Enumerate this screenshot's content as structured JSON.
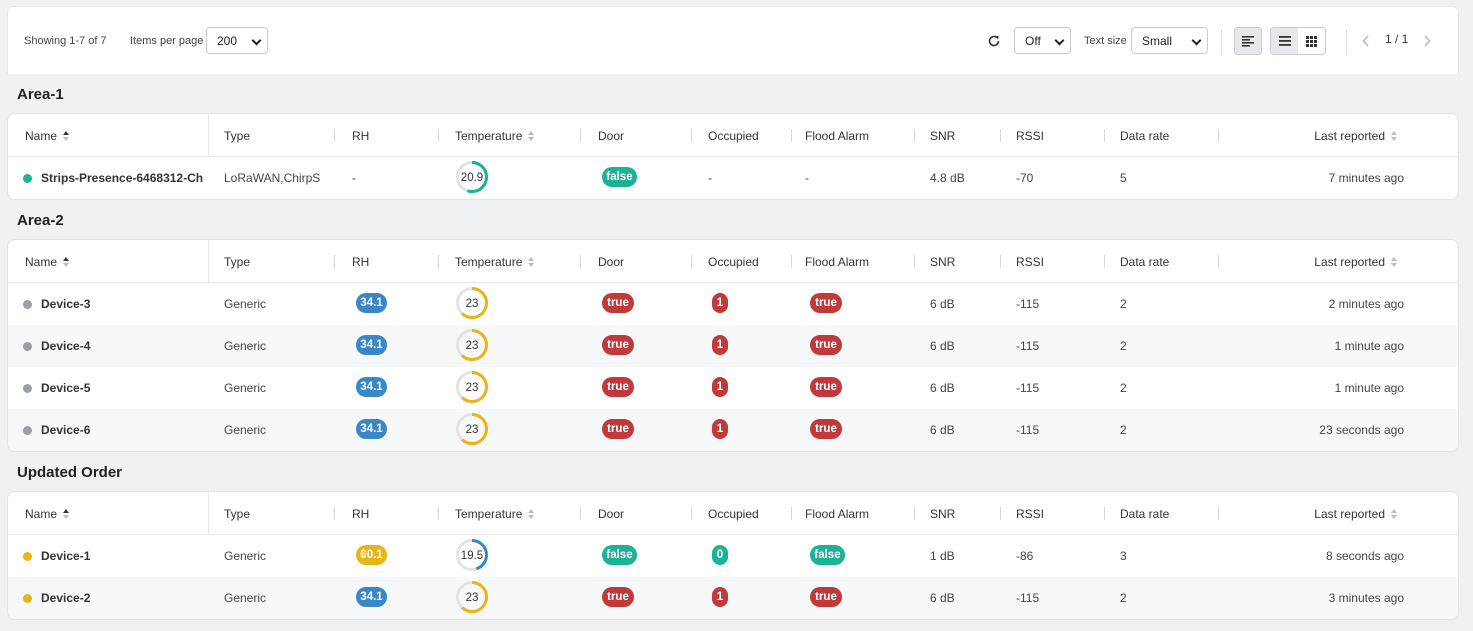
{
  "toolbar": {
    "showing": "Showing 1-7 of 7",
    "items_per_page_label": "Items per page",
    "items_per_page_value": "200",
    "refresh_value": "Off",
    "text_size_label": "Text size",
    "text_size_value": "Small",
    "page_indicator": "1 / 1"
  },
  "columns": [
    "Name",
    "Type",
    "RH",
    "Temperature",
    "Door",
    "Occupied",
    "Flood Alarm",
    "SNR",
    "RSSI",
    "Data rate",
    "Last reported"
  ],
  "colors": {
    "green": "#1ab394",
    "red": "#c0393b",
    "blue": "#3a87c8",
    "yellow": "#e8b416",
    "grey": "#9a9ea5"
  },
  "groups": [
    {
      "title": "Area-1",
      "rows": [
        {
          "status": "green",
          "name": "Strips-Presence-6468312-Ch",
          "type": "LoRaWAN,ChirpSta",
          "rh": "-",
          "rh_color": "",
          "temperature": "20.9",
          "temp_color": "green",
          "door": "false",
          "door_color": "green",
          "occupied": "-",
          "occupied_color": "",
          "flood": "-",
          "flood_color": "",
          "snr": "4.8 dB",
          "rssi": "-70",
          "datarate": "5",
          "last": "7 minutes ago"
        }
      ]
    },
    {
      "title": "Area-2",
      "rows": [
        {
          "status": "grey",
          "name": "Device-3",
          "type": "Generic",
          "rh": "34.1",
          "rh_color": "blue",
          "temperature": "23",
          "temp_color": "yellow",
          "door": "true",
          "door_color": "red",
          "occupied": "1",
          "occupied_color": "red",
          "flood": "true",
          "flood_color": "red",
          "snr": "6 dB",
          "rssi": "-115",
          "datarate": "2",
          "last": "2 minutes ago"
        },
        {
          "status": "grey",
          "name": "Device-4",
          "type": "Generic",
          "rh": "34.1",
          "rh_color": "blue",
          "temperature": "23",
          "temp_color": "yellow",
          "door": "true",
          "door_color": "red",
          "occupied": "1",
          "occupied_color": "red",
          "flood": "true",
          "flood_color": "red",
          "snr": "6 dB",
          "rssi": "-115",
          "datarate": "2",
          "last": "1 minute ago"
        },
        {
          "status": "grey",
          "name": "Device-5",
          "type": "Generic",
          "rh": "34.1",
          "rh_color": "blue",
          "temperature": "23",
          "temp_color": "yellow",
          "door": "true",
          "door_color": "red",
          "occupied": "1",
          "occupied_color": "red",
          "flood": "true",
          "flood_color": "red",
          "snr": "6 dB",
          "rssi": "-115",
          "datarate": "2",
          "last": "1 minute ago"
        },
        {
          "status": "grey",
          "name": "Device-6",
          "type": "Generic",
          "rh": "34.1",
          "rh_color": "blue",
          "temperature": "23",
          "temp_color": "yellow",
          "door": "true",
          "door_color": "red",
          "occupied": "1",
          "occupied_color": "red",
          "flood": "true",
          "flood_color": "red",
          "snr": "6 dB",
          "rssi": "-115",
          "datarate": "2",
          "last": "23 seconds ago"
        }
      ]
    },
    {
      "title": "Updated Order",
      "rows": [
        {
          "status": "yellow",
          "name": "Device-1",
          "type": "Generic",
          "rh": "60.1",
          "rh_color": "yellow",
          "temperature": "19.5",
          "temp_color": "blue",
          "door": "false",
          "door_color": "green",
          "occupied": "0",
          "occupied_color": "green",
          "flood": "false",
          "flood_color": "green",
          "snr": "1 dB",
          "rssi": "-86",
          "datarate": "3",
          "last": "8 seconds ago"
        },
        {
          "status": "yellow",
          "name": "Device-2",
          "type": "Generic",
          "rh": "34.1",
          "rh_color": "blue",
          "temperature": "23",
          "temp_color": "yellow",
          "door": "true",
          "door_color": "red",
          "occupied": "1",
          "occupied_color": "red",
          "flood": "true",
          "flood_color": "red",
          "snr": "6 dB",
          "rssi": "-115",
          "datarate": "2",
          "last": "3 minutes ago"
        }
      ]
    }
  ]
}
